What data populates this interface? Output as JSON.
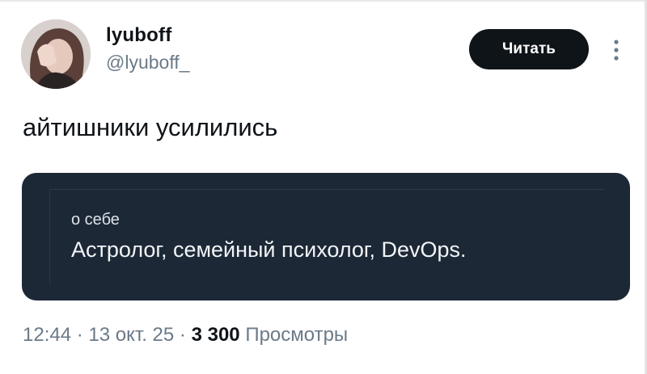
{
  "author": {
    "display_name": "lyuboff",
    "handle": "@lyuboff_"
  },
  "follow_button": {
    "label": "Читать"
  },
  "tweet": {
    "text": "айтишники усилились"
  },
  "bio_card": {
    "label": "о себе",
    "text": "Астролог, семейный психолог, DevOps."
  },
  "meta": {
    "time": "12:44",
    "separator": "·",
    "date": "13 окт. 25",
    "views_count": "3 300",
    "views_label": "Просмотры"
  },
  "icons": {
    "more": "vertical-ellipsis-icon",
    "avatar": "avatar-photo"
  },
  "colors": {
    "text_primary": "#0f1419",
    "text_secondary": "#6b7a88",
    "button_bg": "#0f1419",
    "card_bg": "#1c2836"
  }
}
